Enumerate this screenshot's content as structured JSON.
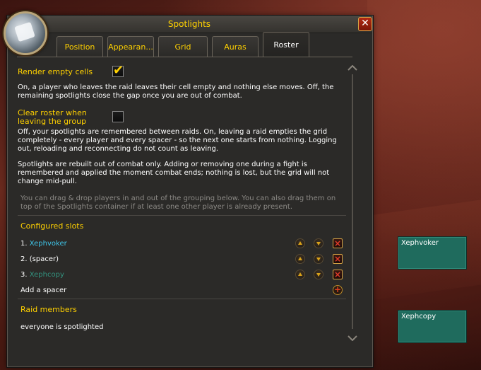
{
  "window": {
    "title": "Spotlights",
    "close_glyph": "✕"
  },
  "tabs": [
    {
      "label": "Position"
    },
    {
      "label": "Appearan..."
    },
    {
      "label": "Grid"
    },
    {
      "label": "Auras"
    },
    {
      "label": "Roster",
      "active": true
    }
  ],
  "options": {
    "render_empty": {
      "label": "Render empty cells",
      "checked": true,
      "description": "On, a player who leaves the raid leaves their cell empty and nothing else moves. Off, the remaining spotlights close the gap once you are out of combat."
    },
    "clear_roster": {
      "label_line1": "Clear roster when",
      "label_line2": "leaving the group",
      "checked": false,
      "description": "Off, your spotlights are remembered between raids. On, leaving a raid empties the grid completely - every player and every spacer - so the next one starts from nothing. Logging out, reloading and reconnecting do not count as leaving."
    },
    "combat_note": "Spotlights are rebuilt out of combat only. Adding or removing one during a fight is remembered and applied the moment combat ends; nothing is lost, but the grid will not change mid-pull.",
    "drag_hint": "You can drag & drop players in and out of the grouping below. You can also drag them on top of the Spotlights container if at least one other player is already present."
  },
  "configured_slots": {
    "heading": "Configured slots",
    "slots": [
      {
        "index": "1.",
        "name": "Xephvoker",
        "class_color": "#3fc7eb"
      },
      {
        "index": "2.",
        "name": "(spacer)",
        "class_color": "#ffffff"
      },
      {
        "index": "3.",
        "name": "Xephcopy",
        "class_color": "#33937f"
      }
    ],
    "add_spacer_label": "Add a spacer"
  },
  "raid_members": {
    "heading": "Raid members",
    "status": "everyone is spotlighted"
  },
  "spotlight_frames": [
    {
      "name": "Xephvoker"
    },
    {
      "name": "Xephcopy"
    }
  ],
  "colors": {
    "gold": "#ffd100",
    "frame_bg": "#1f6b5d",
    "panel_bg": "#2b2a28"
  },
  "icons": {
    "portrait": "bandage-icon",
    "close": "close-icon",
    "checkmark": "checkmark-icon",
    "up": "arrow-up-icon",
    "down": "arrow-down-icon",
    "remove": "remove-icon",
    "add": "plus-icon"
  }
}
